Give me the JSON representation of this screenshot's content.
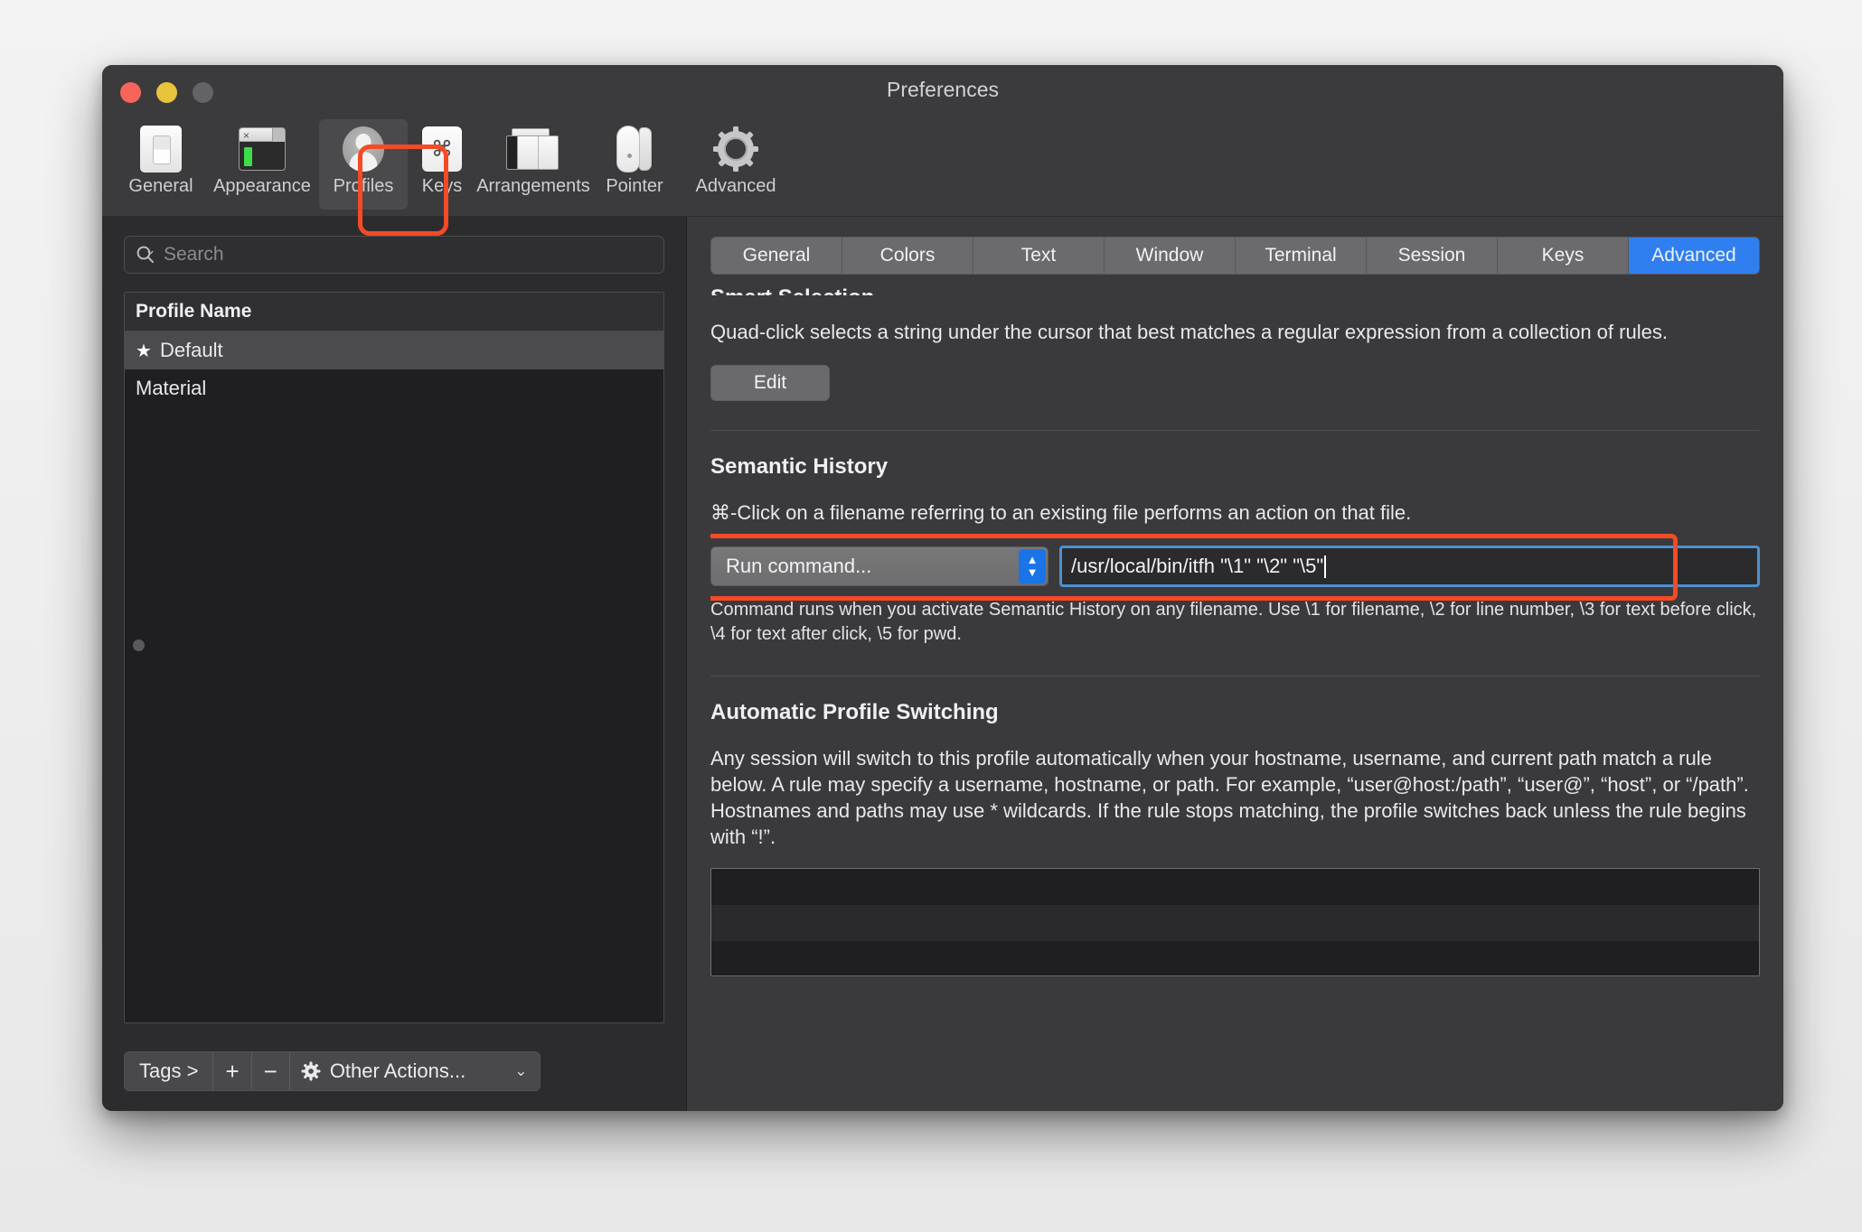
{
  "window": {
    "title": "Preferences",
    "traffic_lights": [
      "close-button",
      "minimize-button",
      "zoom-button"
    ]
  },
  "toolbar": {
    "items": [
      {
        "label": "General",
        "icon": "general-icon",
        "selected": false
      },
      {
        "label": "Appearance",
        "icon": "appearance-icon",
        "selected": false
      },
      {
        "label": "Profiles",
        "icon": "profiles-icon",
        "selected": true
      },
      {
        "label": "Keys",
        "icon": "keys-icon",
        "selected": false
      },
      {
        "label": "Arrangements",
        "icon": "arrangements-icon",
        "selected": false
      },
      {
        "label": "Pointer",
        "icon": "pointer-icon",
        "selected": false
      },
      {
        "label": "Advanced",
        "icon": "gear-icon",
        "selected": false
      }
    ]
  },
  "sidebar": {
    "search": {
      "placeholder": "Search",
      "value": "",
      "icon": "search-icon"
    },
    "table": {
      "column_header": "Profile Name",
      "rows": [
        {
          "name": "Default",
          "starred": true,
          "star": "★",
          "selected": true
        },
        {
          "name": "Material",
          "starred": false,
          "star": "",
          "selected": false
        }
      ]
    },
    "bottom_toolbar": {
      "tags_label": "Tags >",
      "add_label": "+",
      "remove_label": "−",
      "other_actions_label": "Other Actions...",
      "other_actions_caret": "⌄",
      "gear_icon": "gear-icon"
    }
  },
  "panel": {
    "tabs": [
      {
        "label": "General",
        "active": false
      },
      {
        "label": "Colors",
        "active": false
      },
      {
        "label": "Text",
        "active": false
      },
      {
        "label": "Window",
        "active": false
      },
      {
        "label": "Terminal",
        "active": false
      },
      {
        "label": "Session",
        "active": false
      },
      {
        "label": "Keys",
        "active": false
      },
      {
        "label": "Advanced",
        "active": true
      }
    ],
    "smart_selection": {
      "title": "Smart Selection",
      "description": "Quad-click selects a string under the cursor that best matches a regular expression from a collection of rules.",
      "edit_button": "Edit"
    },
    "semantic_history": {
      "title": "Semantic History",
      "description": "⌘-Click on a filename referring to an existing file performs an action on that file.",
      "action_select_value": "Run command...",
      "command_value": "/usr/local/bin/itfh \"\\1\" \"\\2\" \"\\5\"",
      "hint": "Command runs when you activate Semantic History on any filename. Use \\1 for filename, \\2 for line number, \\3 for text before click, \\4 for text after click, \\5 for pwd."
    },
    "automatic_profile_switching": {
      "title": "Automatic Profile Switching",
      "description": "Any session will switch to this profile automatically when your hostname, username, and current path match a rule below. A rule may specify a username, hostname, or path. For example, “user@host:/path”, “user@”, “host”, or “/path”. Hostnames and paths may use * wildcards. If the rule stops matching, the profile switches back unless the rule begins with “!”.",
      "rules": []
    }
  },
  "annotations": {
    "highlight_color": "#f44a26",
    "regions": [
      "profiles-toolbar-item",
      "semantic-history-command-row"
    ]
  },
  "colors": {
    "window_bg": "#3a3a3c",
    "sidebar_bg": "#2c2c2e",
    "list_bg": "#1f1f21",
    "accent_blue": "#2f7ff0",
    "field_focus_ring": "#4f90cc",
    "annotation_red": "#f44a26"
  }
}
